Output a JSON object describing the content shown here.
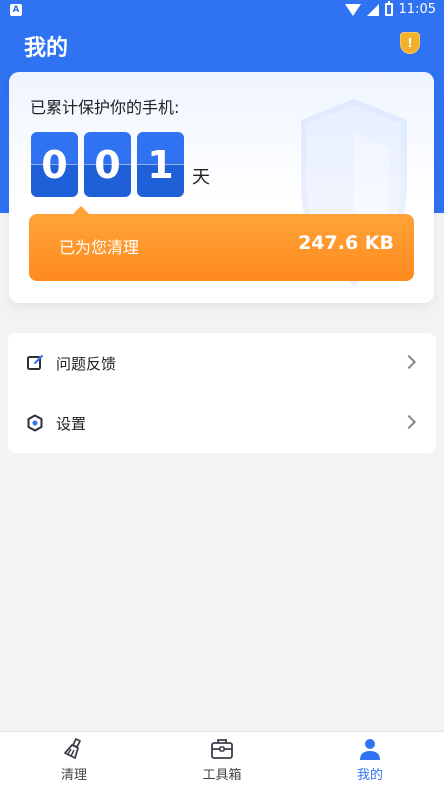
{
  "status_bar": {
    "left_badge": "A",
    "time": "11:05"
  },
  "header": {
    "title": "我的",
    "badge_icon": "shield-alert-icon",
    "badge_mark": "!"
  },
  "protection_card": {
    "label": "已累计保护你的手机:",
    "days_digits": [
      "0",
      "0",
      "1"
    ],
    "days_unit": "天",
    "cleaned_label": "已为您清理",
    "cleaned_value": "247.6 KB"
  },
  "menu": {
    "items": [
      {
        "label": "问题反馈",
        "icon": "feedback-edit-icon"
      },
      {
        "label": "设置",
        "icon": "settings-hexagon-icon"
      }
    ]
  },
  "bottom_nav": {
    "items": [
      {
        "label": "清理",
        "icon": "broom-icon",
        "active": false
      },
      {
        "label": "工具箱",
        "icon": "toolbox-icon",
        "active": false
      },
      {
        "label": "我的",
        "icon": "person-icon",
        "active": true
      }
    ]
  },
  "colors": {
    "primary_blue": "#2f72f2",
    "orange": "#ff8a1f",
    "shield_yellow": "#f3b12a",
    "background": "#f3f3f5"
  }
}
